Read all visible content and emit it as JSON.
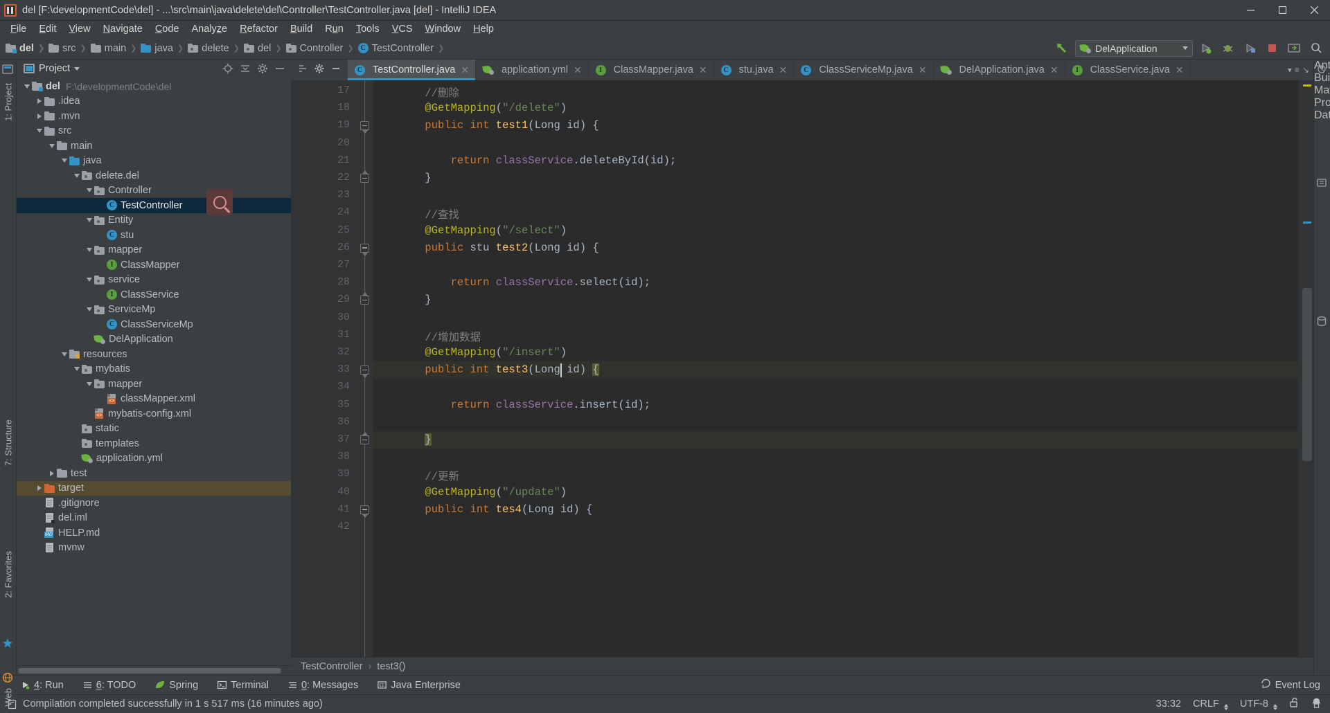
{
  "window": {
    "title": "del [F:\\developmentCode\\del] - ...\\src\\main\\java\\delete\\del\\Controller\\TestController.java [del] - IntelliJ IDEA",
    "minimize": "—",
    "maximize": "▢",
    "close": "✕",
    "app_icon": "intellij-idea-icon"
  },
  "menubar": [
    {
      "label": "File",
      "mn": "F"
    },
    {
      "label": "Edit",
      "mn": "E"
    },
    {
      "label": "View",
      "mn": "V"
    },
    {
      "label": "Navigate",
      "mn": "N"
    },
    {
      "label": "Code",
      "mn": "C"
    },
    {
      "label": "Analyze",
      "mn": "z"
    },
    {
      "label": "Refactor",
      "mn": "R"
    },
    {
      "label": "Build",
      "mn": "B"
    },
    {
      "label": "Run",
      "mn": "u"
    },
    {
      "label": "Tools",
      "mn": "T"
    },
    {
      "label": "VCS",
      "mn": "V"
    },
    {
      "label": "Window",
      "mn": "W"
    },
    {
      "label": "Help",
      "mn": "H"
    }
  ],
  "navbar": {
    "crumbs": [
      {
        "label": "del",
        "icon": "module-folder-icon",
        "bold": true
      },
      {
        "label": "src",
        "icon": "folder-icon",
        "bold": false
      },
      {
        "label": "main",
        "icon": "folder-icon",
        "bold": false
      },
      {
        "label": "java",
        "icon": "source-root-folder-icon",
        "bold": false
      },
      {
        "label": "delete",
        "icon": "package-icon",
        "bold": false
      },
      {
        "label": "del",
        "icon": "package-icon",
        "bold": false
      },
      {
        "label": "Controller",
        "icon": "package-icon",
        "bold": false
      },
      {
        "label": "TestController",
        "icon": "class-icon",
        "bold": false
      }
    ],
    "run_config": "DelApplication",
    "buttons": [
      {
        "name": "arrow-up-left-icon"
      },
      {
        "name": "run-button-icon"
      },
      {
        "name": "debug-button-icon"
      },
      {
        "name": "run-with-coverage-icon"
      },
      {
        "name": "stop-button-icon"
      },
      {
        "name": "update-app-icon"
      },
      {
        "name": "search-everywhere-icon"
      }
    ]
  },
  "project_panel": {
    "title": "Project",
    "header_icons": [
      "target-icon",
      "collapse-all-icon",
      "settings-gear-icon",
      "hide-panel-icon"
    ],
    "tree": [
      {
        "depth": 0,
        "twisty": "open",
        "icon": "module-folder-icon",
        "label": "del",
        "sub": "F:\\developmentCode\\del",
        "bold": true
      },
      {
        "depth": 1,
        "twisty": "closed",
        "icon": "folder-icon",
        "label": ".idea"
      },
      {
        "depth": 1,
        "twisty": "closed",
        "icon": "folder-icon",
        "label": ".mvn"
      },
      {
        "depth": 1,
        "twisty": "open",
        "icon": "folder-icon",
        "label": "src"
      },
      {
        "depth": 2,
        "twisty": "open",
        "icon": "folder-icon",
        "label": "main"
      },
      {
        "depth": 3,
        "twisty": "open",
        "icon": "source-root-folder-icon",
        "label": "java"
      },
      {
        "depth": 4,
        "twisty": "open",
        "icon": "package-icon",
        "label": "delete.del"
      },
      {
        "depth": 5,
        "twisty": "open",
        "icon": "package-icon",
        "label": "Controller"
      },
      {
        "depth": 6,
        "twisty": "none",
        "icon": "class-icon",
        "label": "TestController",
        "selected": true
      },
      {
        "depth": 5,
        "twisty": "open",
        "icon": "package-icon",
        "label": "Entity"
      },
      {
        "depth": 6,
        "twisty": "none",
        "icon": "class-icon",
        "label": "stu"
      },
      {
        "depth": 5,
        "twisty": "open",
        "icon": "package-icon",
        "label": "mapper"
      },
      {
        "depth": 6,
        "twisty": "none",
        "icon": "interface-icon",
        "label": "ClassMapper"
      },
      {
        "depth": 5,
        "twisty": "open",
        "icon": "package-icon",
        "label": "service"
      },
      {
        "depth": 6,
        "twisty": "none",
        "icon": "interface-icon",
        "label": "ClassService"
      },
      {
        "depth": 5,
        "twisty": "open",
        "icon": "package-icon",
        "label": "ServiceMp"
      },
      {
        "depth": 6,
        "twisty": "none",
        "icon": "class-icon",
        "label": "ClassServiceMp"
      },
      {
        "depth": 5,
        "twisty": "none",
        "icon": "spring-boot-icon",
        "label": "DelApplication"
      },
      {
        "depth": 3,
        "twisty": "open",
        "icon": "resource-root-folder-icon",
        "label": "resources"
      },
      {
        "depth": 4,
        "twisty": "open",
        "icon": "package-icon",
        "label": "mybatis"
      },
      {
        "depth": 5,
        "twisty": "open",
        "icon": "package-icon",
        "label": "mapper"
      },
      {
        "depth": 6,
        "twisty": "none",
        "icon": "xml-file-icon",
        "label": "classMapper.xml"
      },
      {
        "depth": 5,
        "twisty": "none",
        "icon": "xml-file-icon",
        "label": "mybatis-config.xml"
      },
      {
        "depth": 4,
        "twisty": "none",
        "icon": "package-icon",
        "label": "static"
      },
      {
        "depth": 4,
        "twisty": "none",
        "icon": "package-icon",
        "label": "templates"
      },
      {
        "depth": 4,
        "twisty": "none",
        "icon": "spring-yaml-icon",
        "label": "application.yml"
      },
      {
        "depth": 2,
        "twisty": "closed",
        "icon": "folder-icon",
        "label": "test"
      },
      {
        "depth": 1,
        "twisty": "closed",
        "icon": "excluded-folder-icon",
        "label": "target",
        "highlight": "target"
      },
      {
        "depth": 1,
        "twisty": "none",
        "icon": "file-icon",
        "label": ".gitignore"
      },
      {
        "depth": 1,
        "twisty": "none",
        "icon": "iml-file-icon",
        "label": "del.iml"
      },
      {
        "depth": 1,
        "twisty": "none",
        "icon": "markdown-file-icon",
        "label": "HELP.md"
      },
      {
        "depth": 1,
        "twisty": "none",
        "icon": "file-icon",
        "label": "mvnw"
      }
    ]
  },
  "left_rail": [
    {
      "label": "1: Project",
      "name": "tool-window-project"
    },
    {
      "label": "7: Structure",
      "name": "tool-window-structure"
    },
    {
      "label": "2: Favorites",
      "name": "tool-window-favorites"
    },
    {
      "label": "Web",
      "name": "tool-window-web"
    }
  ],
  "right_rail": [
    {
      "label": "Ant Build",
      "name": "tool-window-ant-build"
    },
    {
      "label": "Maven Projects",
      "name": "tool-window-maven"
    },
    {
      "label": "Database",
      "name": "tool-window-database"
    }
  ],
  "editor_tabs": [
    {
      "label": "TestController.java",
      "icon": "class-icon",
      "active": true
    },
    {
      "label": "application.yml",
      "icon": "spring-yaml-icon",
      "active": false
    },
    {
      "label": "ClassMapper.java",
      "icon": "interface-icon",
      "active": false
    },
    {
      "label": "stu.java",
      "icon": "class-icon",
      "active": false
    },
    {
      "label": "ClassServiceMp.java",
      "icon": "class-icon",
      "active": false
    },
    {
      "label": "DelApplication.java",
      "icon": "spring-boot-icon",
      "active": false
    },
    {
      "label": "ClassService.java",
      "icon": "interface-icon",
      "active": false
    }
  ],
  "code": {
    "first_line": 17,
    "lines": [
      {
        "n": 17,
        "tokens": [
          {
            "t": "        ",
            "c": "pl"
          },
          {
            "t": "//删除",
            "c": "cm"
          }
        ]
      },
      {
        "n": 18,
        "tokens": [
          {
            "t": "        ",
            "c": "pl"
          },
          {
            "t": "@GetMapping",
            "c": "an"
          },
          {
            "t": "(",
            "c": "pl"
          },
          {
            "t": "\"/delete\"",
            "c": "str"
          },
          {
            "t": ")",
            "c": "pl"
          }
        ]
      },
      {
        "n": 19,
        "tokens": [
          {
            "t": "        ",
            "c": "pl"
          },
          {
            "t": "public ",
            "c": "k"
          },
          {
            "t": "int ",
            "c": "k"
          },
          {
            "t": "test1",
            "c": "mth"
          },
          {
            "t": "(",
            "c": "pl"
          },
          {
            "t": "Long",
            "c": "pl"
          },
          {
            "t": " id) {",
            "c": "pl"
          }
        ]
      },
      {
        "n": 20,
        "tokens": []
      },
      {
        "n": 21,
        "tokens": [
          {
            "t": "            ",
            "c": "pl"
          },
          {
            "t": "return ",
            "c": "k"
          },
          {
            "t": "classService",
            "c": "fld"
          },
          {
            "t": ".deleteById(id);",
            "c": "pl"
          }
        ]
      },
      {
        "n": 22,
        "tokens": [
          {
            "t": "        }",
            "c": "pl"
          }
        ]
      },
      {
        "n": 23,
        "tokens": []
      },
      {
        "n": 24,
        "tokens": [
          {
            "t": "        ",
            "c": "pl"
          },
          {
            "t": "//查找",
            "c": "cm"
          }
        ]
      },
      {
        "n": 25,
        "tokens": [
          {
            "t": "        ",
            "c": "pl"
          },
          {
            "t": "@GetMapping",
            "c": "an"
          },
          {
            "t": "(",
            "c": "pl"
          },
          {
            "t": "\"/select\"",
            "c": "str"
          },
          {
            "t": ")",
            "c": "pl"
          }
        ]
      },
      {
        "n": 26,
        "tokens": [
          {
            "t": "        ",
            "c": "pl"
          },
          {
            "t": "public ",
            "c": "k"
          },
          {
            "t": "stu ",
            "c": "pl"
          },
          {
            "t": "test2",
            "c": "mth"
          },
          {
            "t": "(",
            "c": "pl"
          },
          {
            "t": "Long",
            "c": "pl"
          },
          {
            "t": " id) {",
            "c": "pl"
          }
        ]
      },
      {
        "n": 27,
        "tokens": []
      },
      {
        "n": 28,
        "tokens": [
          {
            "t": "            ",
            "c": "pl"
          },
          {
            "t": "return ",
            "c": "k"
          },
          {
            "t": "classService",
            "c": "fld"
          },
          {
            "t": ".select(id);",
            "c": "pl"
          }
        ]
      },
      {
        "n": 29,
        "tokens": [
          {
            "t": "        }",
            "c": "pl"
          }
        ]
      },
      {
        "n": 30,
        "tokens": []
      },
      {
        "n": 31,
        "tokens": [
          {
            "t": "        ",
            "c": "pl"
          },
          {
            "t": "//增加数据",
            "c": "cm"
          }
        ]
      },
      {
        "n": 32,
        "tokens": [
          {
            "t": "        ",
            "c": "pl"
          },
          {
            "t": "@GetMapping",
            "c": "an"
          },
          {
            "t": "(",
            "c": "pl"
          },
          {
            "t": "\"/insert\"",
            "c": "str"
          },
          {
            "t": ")",
            "c": "pl"
          }
        ]
      },
      {
        "n": 33,
        "tokens": [
          {
            "t": "        ",
            "c": "pl"
          },
          {
            "t": "public ",
            "c": "k"
          },
          {
            "t": "int ",
            "c": "k"
          },
          {
            "t": "test3",
            "c": "mth"
          },
          {
            "t": "(",
            "c": "pl"
          },
          {
            "t": "Long",
            "c": "pl"
          },
          {
            "t": " id) ",
            "c": "pl"
          },
          {
            "t": "{",
            "c": "pl",
            "hl": true
          }
        ]
      },
      {
        "n": 34,
        "tokens": []
      },
      {
        "n": 35,
        "tokens": [
          {
            "t": "            ",
            "c": "pl"
          },
          {
            "t": "return ",
            "c": "k"
          },
          {
            "t": "classService",
            "c": "fld"
          },
          {
            "t": ".insert(id);",
            "c": "pl"
          }
        ]
      },
      {
        "n": 36,
        "tokens": []
      },
      {
        "n": 37,
        "tokens": [
          {
            "t": "        ",
            "c": "pl"
          },
          {
            "t": "}",
            "c": "pl",
            "hl": true
          }
        ]
      },
      {
        "n": 38,
        "tokens": []
      },
      {
        "n": 39,
        "tokens": [
          {
            "t": "        ",
            "c": "pl"
          },
          {
            "t": "//更新",
            "c": "cm"
          }
        ]
      },
      {
        "n": 40,
        "tokens": [
          {
            "t": "        ",
            "c": "pl"
          },
          {
            "t": "@GetMapping",
            "c": "an"
          },
          {
            "t": "(",
            "c": "pl"
          },
          {
            "t": "\"/update\"",
            "c": "str"
          },
          {
            "t": ")",
            "c": "pl"
          }
        ]
      },
      {
        "n": 41,
        "tokens": [
          {
            "t": "        ",
            "c": "pl"
          },
          {
            "t": "public ",
            "c": "k"
          },
          {
            "t": "int ",
            "c": "k"
          },
          {
            "t": "tes4",
            "c": "mth"
          },
          {
            "t": "(",
            "c": "pl"
          },
          {
            "t": "Long",
            "c": "pl"
          },
          {
            "t": " id) {",
            "c": "pl"
          }
        ]
      },
      {
        "n": 42,
        "tokens": []
      }
    ]
  },
  "editor_breadcrumb": {
    "class": "TestController",
    "sep": "›",
    "method": "test3()"
  },
  "bottom_toolwindows": [
    {
      "num": "4",
      "label": ": Run",
      "icon": "run-icon"
    },
    {
      "num": "6",
      "label": ": TODO",
      "icon": "todo-icon"
    },
    {
      "num": "",
      "label": "Spring",
      "icon": "spring-leaf-icon"
    },
    {
      "num": "",
      "label": "Terminal",
      "icon": "terminal-icon"
    },
    {
      "num": "0",
      "label": ": Messages",
      "icon": "messages-icon"
    },
    {
      "num": "",
      "label": "Java Enterprise",
      "icon": "java-enterprise-icon"
    }
  ],
  "event_log_label": "Event Log",
  "statusbar": {
    "message": "Compilation completed successfully in 1 s 517 ms (16 minutes ago)",
    "message_icon": "build-icon",
    "caret_position": "33:32",
    "line_separator": "CRLF",
    "encoding": "UTF-8",
    "lock_icon": "unlocked-icon",
    "inspector_icon": "hector-inspector-icon"
  },
  "colors": {
    "accent": "#3592c4",
    "chrome": "#3c3f41",
    "editor_bg": "#2b2b2b",
    "gutter_bg": "#313335",
    "selection": "#0d293e",
    "keyword": "#cc7832",
    "annotation": "#bbb529",
    "string": "#6a8759",
    "comment": "#808080",
    "field": "#9876aa",
    "method": "#ffc66d",
    "default_text": "#a9b7c6",
    "spring_green": "#6db33f",
    "target_highlight": "#544b30"
  }
}
